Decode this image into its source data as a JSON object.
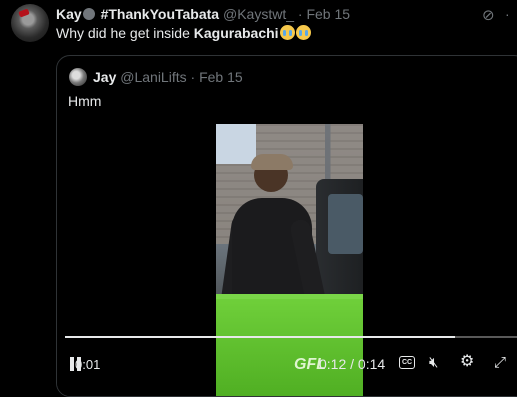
{
  "post": {
    "author_name": "Kay",
    "author_hashtag": "#ThankYouTabata",
    "author_handle": "@Kaystwt_",
    "separator": "·",
    "date": "Feb 15",
    "text_prefix": "Why did he get inside ",
    "text_bold": "Kagurabachi"
  },
  "quote": {
    "author_name": "Jay",
    "author_handle": "@LaniLifts",
    "separator": "·",
    "date": "Feb 15",
    "text": "Hmm"
  },
  "video": {
    "position_time": "0:01",
    "duration_display": "0:12 / 0:14",
    "progress": 0.86,
    "brand_text": "GFL",
    "cc_label": "CC"
  },
  "icons": {
    "grok": "grok-icon",
    "more": "more-icon",
    "pause": "pause-icon",
    "captions": "captions-icon",
    "volume": "volume-muted-icon",
    "settings": "gear-icon",
    "fullscreen": "expand-icon"
  },
  "colors": {
    "background": "#000000",
    "text": "#e7e9ea",
    "secondary": "#71767b",
    "border": "#2f3336",
    "bin_green": "#5cc02c"
  }
}
